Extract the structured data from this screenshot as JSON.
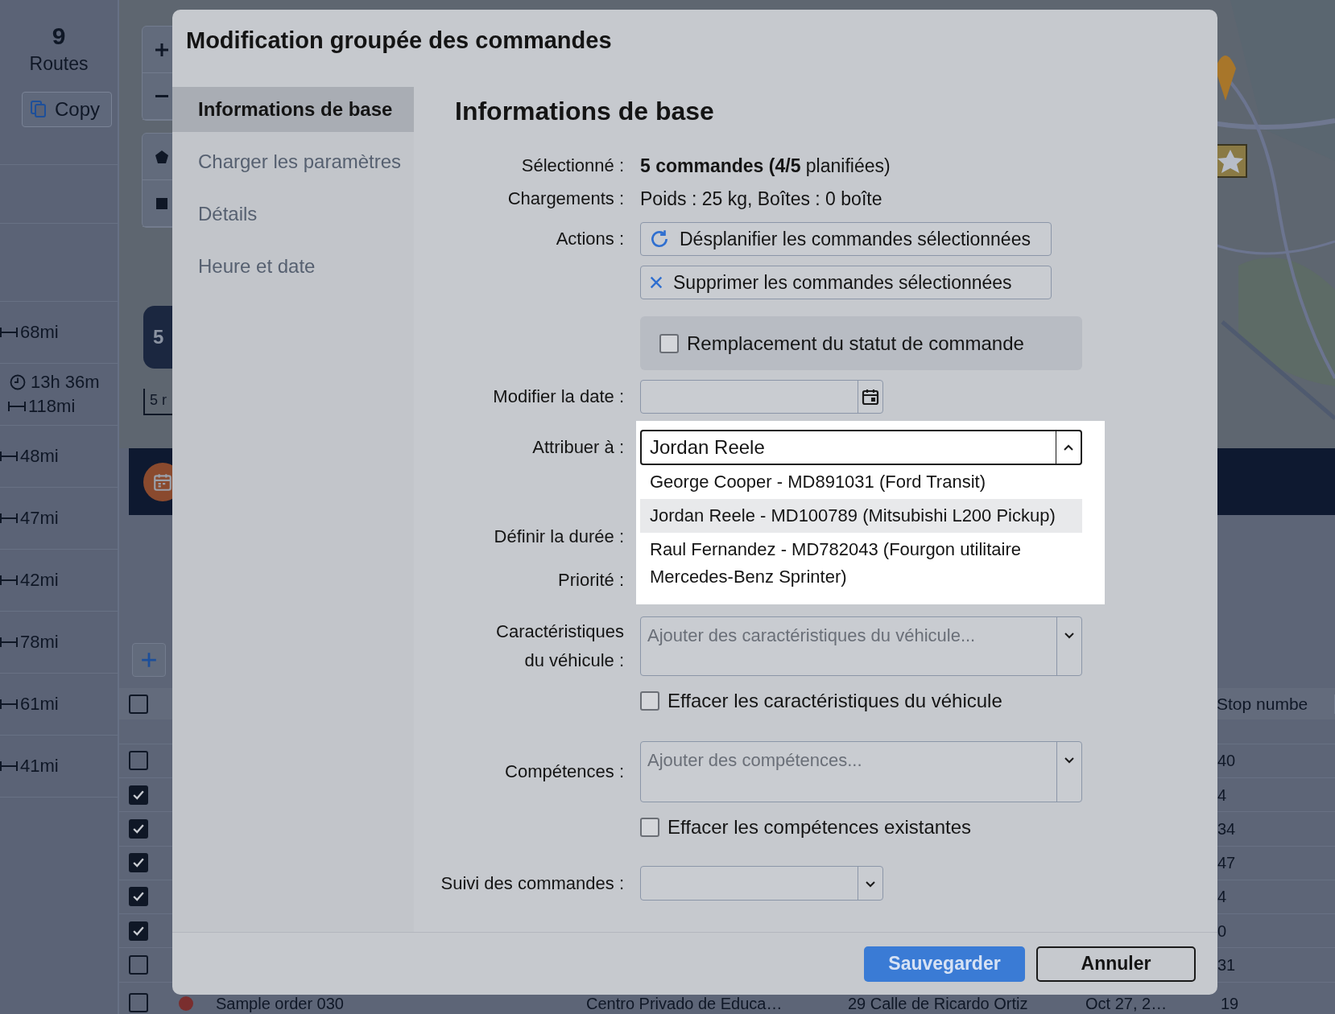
{
  "routes_panel": {
    "count": "9",
    "label": "Routes",
    "copy_button": "Copy",
    "routes": [
      {
        "distance": "68mi"
      },
      {
        "duration": "13h 36m",
        "distance": "118mi"
      },
      {
        "distance": "48mi"
      },
      {
        "distance": "47mi"
      },
      {
        "distance": "42mi"
      },
      {
        "distance": "78mi"
      },
      {
        "distance": "61mi"
      },
      {
        "distance": "41mi"
      }
    ]
  },
  "map": {
    "cluster_badge": "5",
    "scale": "5 r"
  },
  "table": {
    "select_all_checked": false,
    "columns": [
      {
        "label": "Stop numbe"
      }
    ],
    "rows": [
      {
        "checked": false,
        "stop_number": "40"
      },
      {
        "checked": true,
        "stop_number": "4"
      },
      {
        "checked": true,
        "stop_number": "34"
      },
      {
        "checked": true,
        "stop_number": "47"
      },
      {
        "checked": true,
        "stop_number": "4"
      },
      {
        "checked": true,
        "stop_number": "0"
      },
      {
        "checked": false,
        "stop_number": "31"
      },
      {
        "checked": false,
        "color": "#7a2e2e",
        "order": "Sample order 030",
        "place": "Centro Privado de Educa…",
        "address": "29 Calle de Ricardo Ortiz",
        "date": "Oct 27, 2…",
        "stop_number": "19"
      }
    ]
  },
  "dialog": {
    "title": "Modification groupée des commandes",
    "sidebar": [
      {
        "label": "Informations de base",
        "selected": true
      },
      {
        "label": "Charger les paramètres",
        "selected": false
      },
      {
        "label": "Détails",
        "selected": false
      },
      {
        "label": "Heure et date",
        "selected": false
      }
    ],
    "heading": "Informations de base",
    "selected": {
      "label": "Sélectionné :",
      "value": "**5 commandes** **(4/5** planifiées)"
    },
    "loads": {
      "label": "Chargements :",
      "value": "Poids : 25 kg, Boîtes : 0 boîte"
    },
    "actions": {
      "label": "Actions :",
      "buttons": [
        {
          "kind": "unplan",
          "label": "Désplanifier les commandes sélectionnées"
        },
        {
          "kind": "delete",
          "label": "Supprimer les commandes sélectionnées"
        }
      ]
    },
    "status_override": {
      "label": "Remplacement du statut de commande",
      "checked": false
    },
    "date": {
      "label": "Modifier la date :"
    },
    "assign": {
      "label": "Attribuer à :",
      "value": "Jordan Reele",
      "expanded": true,
      "options": [
        {
          "label": "George Cooper - MD891031 (Ford Transit)",
          "selected": false
        },
        {
          "label": "Jordan Reele - MD100789 (Mitsubishi L200 Pickup)",
          "selected": true
        },
        {
          "label": "Raul Fernandez - MD782043 (Fourgon utilitaire Mercedes-Benz Sprinter)",
          "selected": false
        }
      ]
    },
    "duration": {
      "label": "Définir la durée :"
    },
    "priority": {
      "label": "Priorité :"
    },
    "vehicle_features": {
      "label": "Caractéristiques du véhicule :",
      "placeholder": "Ajouter des caractéristiques du véhicule...",
      "clear": {
        "label": "Effacer les caractéristiques du véhicule",
        "checked": false
      }
    },
    "skills": {
      "label": "Compétences :",
      "placeholder": "Ajouter des compétences...",
      "clear": {
        "label": "Effacer les compétences existantes",
        "checked": false
      }
    },
    "tracking": {
      "label": "Suivi des commandes :"
    },
    "buttons": [
      {
        "kind": "primary",
        "label": "Sauvegarder"
      },
      {
        "kind": "secondary",
        "label": "Annuler"
      }
    ]
  }
}
